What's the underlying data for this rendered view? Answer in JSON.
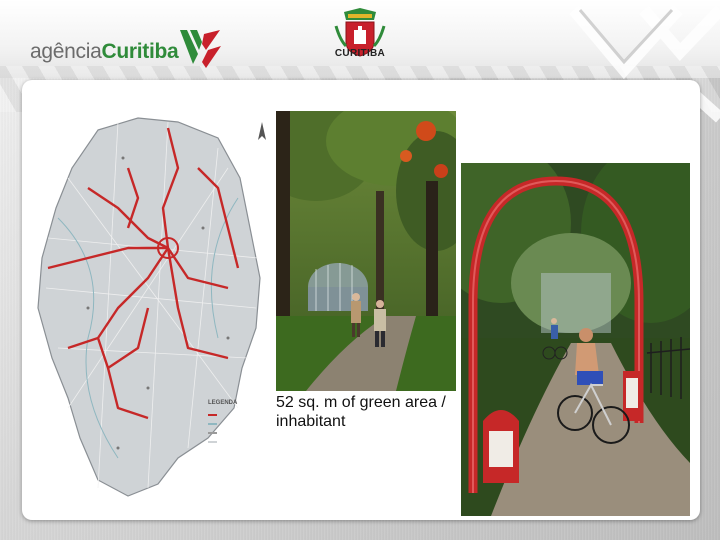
{
  "header": {
    "logo_prefix": "agência",
    "logo_suffix": "Curitiba",
    "seal_label": "CURITIBA"
  },
  "photos": {
    "caption": "52 sq. m of green area / inhabitant"
  },
  "map": {
    "legend_title": "LEGENDA",
    "legend_items": [
      "",
      "",
      "",
      ""
    ]
  },
  "colors": {
    "brand_green": "#2f8b3a",
    "brand_red": "#c8202b",
    "route_red": "#c62828"
  },
  "icons": [
    "agencia-curitiba-logo-icon",
    "curitiba-seal-icon",
    "north-arrow-icon"
  ]
}
